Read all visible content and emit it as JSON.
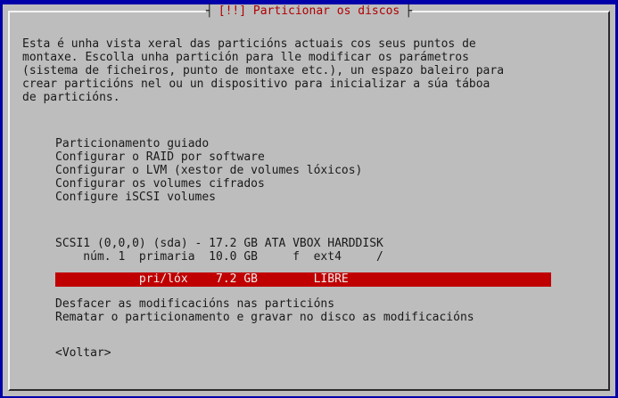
{
  "dialog": {
    "title": "[!!] Particionar os discos"
  },
  "description": [
    "Esta é unha vista xeral das particións actuais cos seus puntos de",
    "montaxe. Escolla unha partición para lle modificar os parámetros",
    "(sistema de ficheiros, punto de montaxe etc.), un espazo baleiro para",
    "crear particións nel ou un dispositivo para inicializar a súa táboa",
    "de particións."
  ],
  "menu": {
    "actions": [
      "Particionamento guiado",
      "Configurar o RAID por software",
      "Configurar o LVM (xestor de volumes lóxicos)",
      "Configurar os volumes cifrados",
      "Configure iSCSI volumes"
    ],
    "disk": "SCSI1 (0,0,0) (sda) - 17.2 GB ATA VBOX HARDDISK",
    "partition": "    núm. 1  primaria  10.0 GB     f  ext4     /",
    "free_space": "            pri/lóx    7.2 GB        LIBRE",
    "undo": "Desfacer as modificacións nas particións",
    "finish": "Rematar o particionamento e gravar no disco as modificacións",
    "back": "<Voltar>"
  },
  "colors": {
    "background": "#0000aa",
    "dialog": "#bdbdbd",
    "title": "#b00000",
    "selection": "#c00000"
  }
}
